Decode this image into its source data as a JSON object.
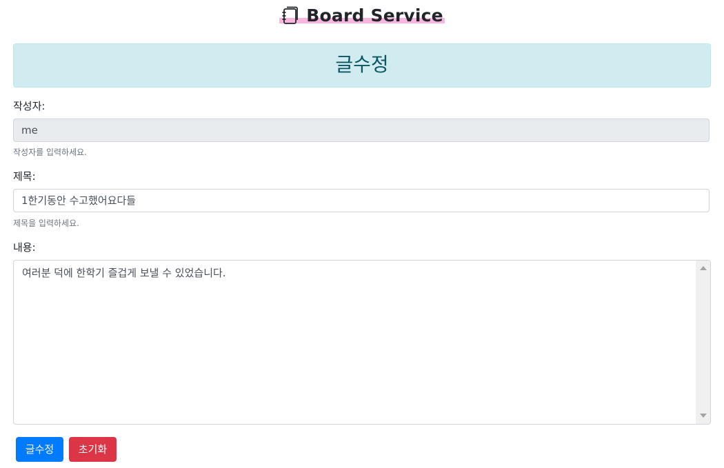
{
  "header": {
    "title": "Board Service",
    "icon": "journal-icon"
  },
  "banner": {
    "text": "글수정",
    "bg_color": "#d1ecf1",
    "text_color": "#0c5460"
  },
  "form": {
    "author": {
      "label": "작성자:",
      "value": "me",
      "help": "작성자를 입력하세요."
    },
    "title": {
      "label": "제목:",
      "value": "1한기동안 수고했어요다들",
      "help": "제목을 입력하세요."
    },
    "content": {
      "label": "내용:",
      "value": "여러분 덕에 한학기 즐겁게 보낼 수 있었습니다."
    }
  },
  "buttons": {
    "submit_label": "글수정",
    "reset_label": "초기화",
    "submit_color": "#007bff",
    "reset_color": "#dc3545"
  }
}
